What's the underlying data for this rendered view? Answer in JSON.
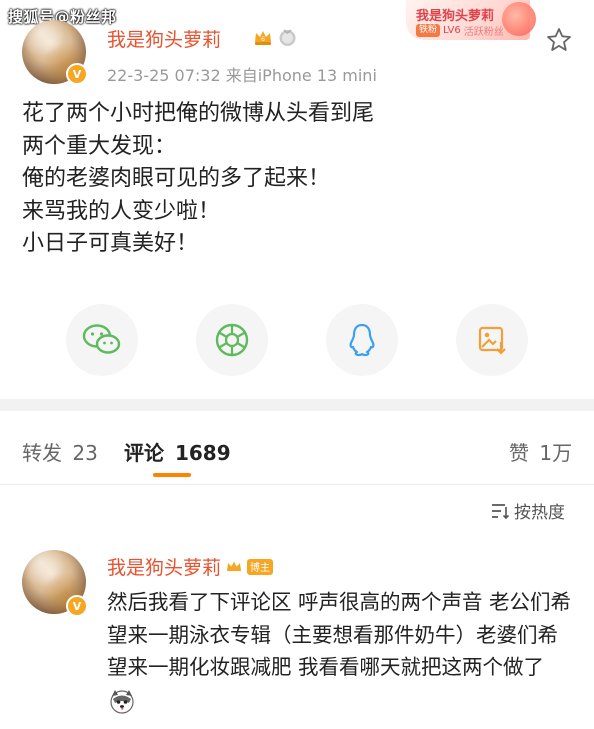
{
  "watermark": "搜狐号@粉丝邦",
  "fan_badge": {
    "name": "我是狗头萝莉",
    "crown_tag": "铁粉",
    "level": "LV6",
    "tag": "活跃粉丝"
  },
  "post": {
    "username": "我是狗头萝莉",
    "meta": "22-3-25 07:32  来自iPhone 13 mini",
    "lines": [
      "花了两个小时把俺的微博从头看到尾",
      "两个重大发现：",
      "俺的老婆肉眼可见的多了起来！",
      "来骂我的人变少啦！",
      "小日子可真美好！"
    ]
  },
  "share_icons": [
    "wechat-icon",
    "moments-icon",
    "qq-icon",
    "save-image-icon"
  ],
  "tabs": {
    "repost_label": "转发",
    "repost_count": "23",
    "comment_label": "评论",
    "comment_count": "1689",
    "like_label": "赞",
    "like_count": "1万"
  },
  "sort_label": "按热度",
  "comment": {
    "username": "我是狗头萝莉",
    "tag": "博主",
    "text": "然后我看了下评论区 呼声很高的两个声音 老公们希望来一期泳衣专辑（主要想看那件奶牛）老婆们希望来一期化妆跟减肥 我看看哪天就把这两个做了"
  },
  "colors": {
    "username": "#e8522f",
    "accent": "#ff8200",
    "verified": "#f6a623"
  }
}
